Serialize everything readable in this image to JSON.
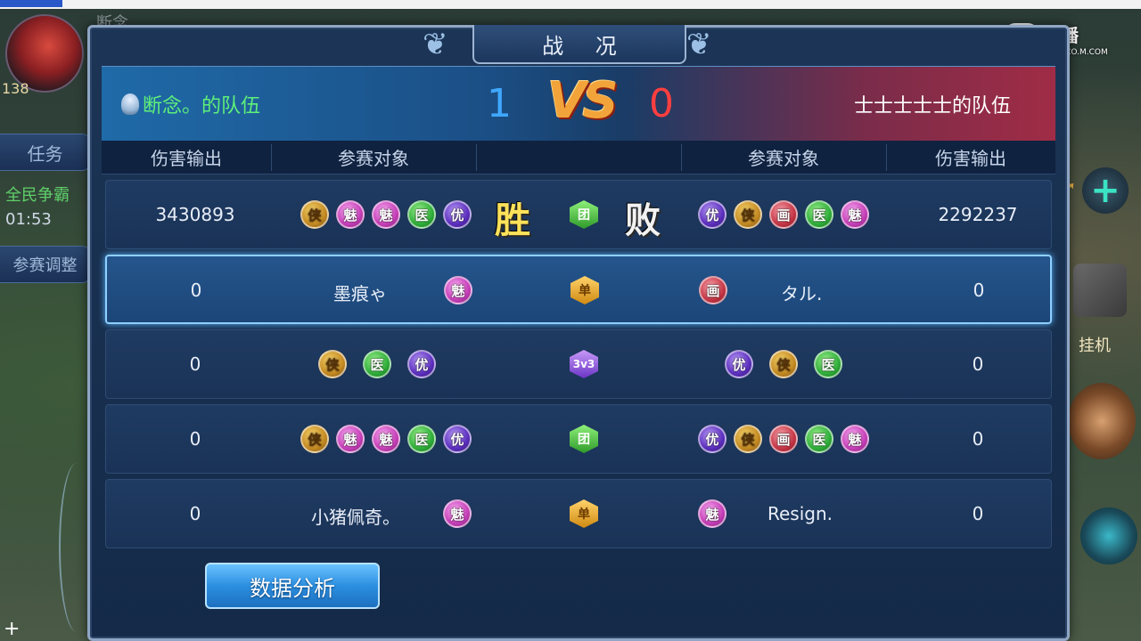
{
  "window": {
    "title": "战 况"
  },
  "background": {
    "player_level": "138",
    "ghost_name": "断念",
    "task_label": "任务",
    "event_label": "全民争霸",
    "event_timer": "01:53",
    "adjust_label": "参赛调整",
    "afk_label": "挂机",
    "watermark": "直播",
    "watermark_sub": "C.CO.M.COM"
  },
  "score": {
    "left_team": "断念。的队伍",
    "left_score": "1",
    "vs_label": "VS",
    "right_score": "0",
    "right_team": "士士士士士的队伍"
  },
  "headers": {
    "dmg_left": "伤害输出",
    "player_left": "参赛对象",
    "player_right": "参赛对象",
    "dmg_right": "伤害输出"
  },
  "rows": [
    {
      "dmg_left": "3430893",
      "dmg_right": "2292237",
      "mode": "团",
      "win": "胜",
      "lose": "败"
    },
    {
      "dmg_left": "0",
      "dmg_right": "0",
      "mode": "单",
      "name_left": "墨痕ゃ",
      "name_right": "タル."
    },
    {
      "dmg_left": "0",
      "dmg_right": "0",
      "mode": "3v3"
    },
    {
      "dmg_left": "0",
      "dmg_right": "0",
      "mode": "团"
    },
    {
      "dmg_left": "0",
      "dmg_right": "0",
      "mode": "单",
      "name_left": "小猪佩奇。",
      "name_right": "Resign."
    }
  ],
  "class_glyphs": {
    "xia": "侠",
    "mei": "魅",
    "yi": "医",
    "you": "优",
    "hua": "画"
  },
  "buttons": {
    "analyze": "数据分析"
  },
  "colors": {
    "left_team": "#5ff07a",
    "left_score": "#3fa8ff",
    "right_score": "#ff3f3f",
    "vs": "#f2a43a",
    "win": "#ffe25a"
  }
}
